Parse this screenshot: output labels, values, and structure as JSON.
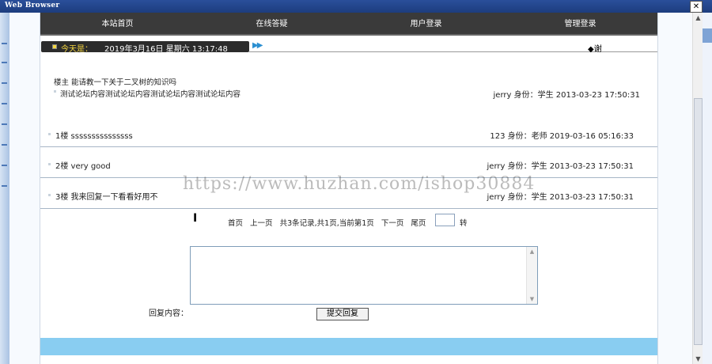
{
  "window": {
    "title": "Web Browser",
    "close_glyph": "✕"
  },
  "nav": [
    "本站首页",
    "在线答疑",
    "用户登录",
    "管理登录"
  ],
  "datebar": {
    "label": "今天是：",
    "datetime": "2019年3月16日 星期六 13:17:48",
    "ff_glyph": "▶▶",
    "right_text": "◆谢"
  },
  "topic": {
    "header": "楼主 能请教一下关于二叉树的知识吗",
    "content": "测试论坛内容测试论坛内容测试论坛内容测试论坛内容",
    "meta": "jerry 身份：学生 2013-03-23 17:50:31"
  },
  "replies": [
    {
      "text": "1楼 sssssssssssssss",
      "meta": "123 身份：老师 2019-03-16 05:16:33"
    },
    {
      "text": "2楼 very good",
      "meta": "jerry 身份：学生 2013-03-23 17:50:31"
    },
    {
      "text": "3楼 我来回复一下看看好用不",
      "meta": "jerry 身份：学生 2013-03-23 17:50:31"
    }
  ],
  "pager": {
    "first": "首页",
    "prev": "上一页",
    "summary": "共3条记录,共1页,当前第1页",
    "next": "下一页",
    "last": "尾页",
    "go": "转"
  },
  "reply_form": {
    "label": "回复内容：",
    "submit": "提交回复"
  },
  "watermark": "https://www.huzhan.com/ishop30884",
  "colors": {
    "nav_bg": "#3a3a3a",
    "footer": "#89cdf1",
    "date_label": "#f4d640"
  }
}
